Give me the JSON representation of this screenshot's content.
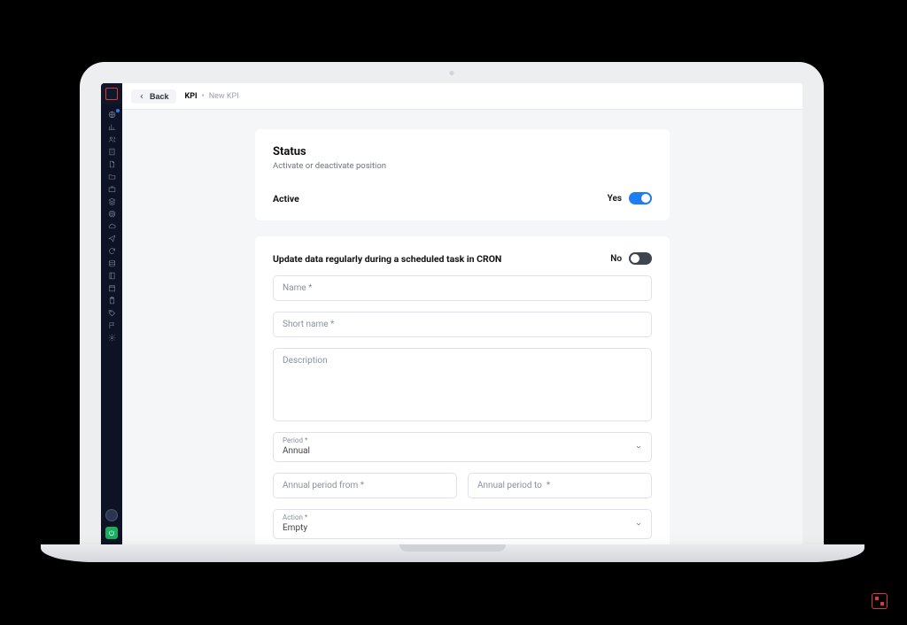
{
  "topbar": {
    "back": "Back",
    "crumb_root": "KPI",
    "crumb_sep": "•",
    "crumb_current": "New KPI"
  },
  "status_card": {
    "title": "Status",
    "subtitle": "Activate or deactivate position",
    "active_label": "Active",
    "active_value_text": "Yes"
  },
  "form_card": {
    "cron_label": "Update data regularly during a scheduled task in CRON",
    "cron_value_text": "No",
    "name_placeholder": "Name *",
    "shortname_placeholder": "Short name *",
    "description_placeholder": "Description",
    "period_label": "Period *",
    "period_value": "Annual",
    "period_from_placeholder": "Annual period from *",
    "period_to_placeholder": "Annual period to  *",
    "action_label": "Action *",
    "action_value": "Empty"
  }
}
